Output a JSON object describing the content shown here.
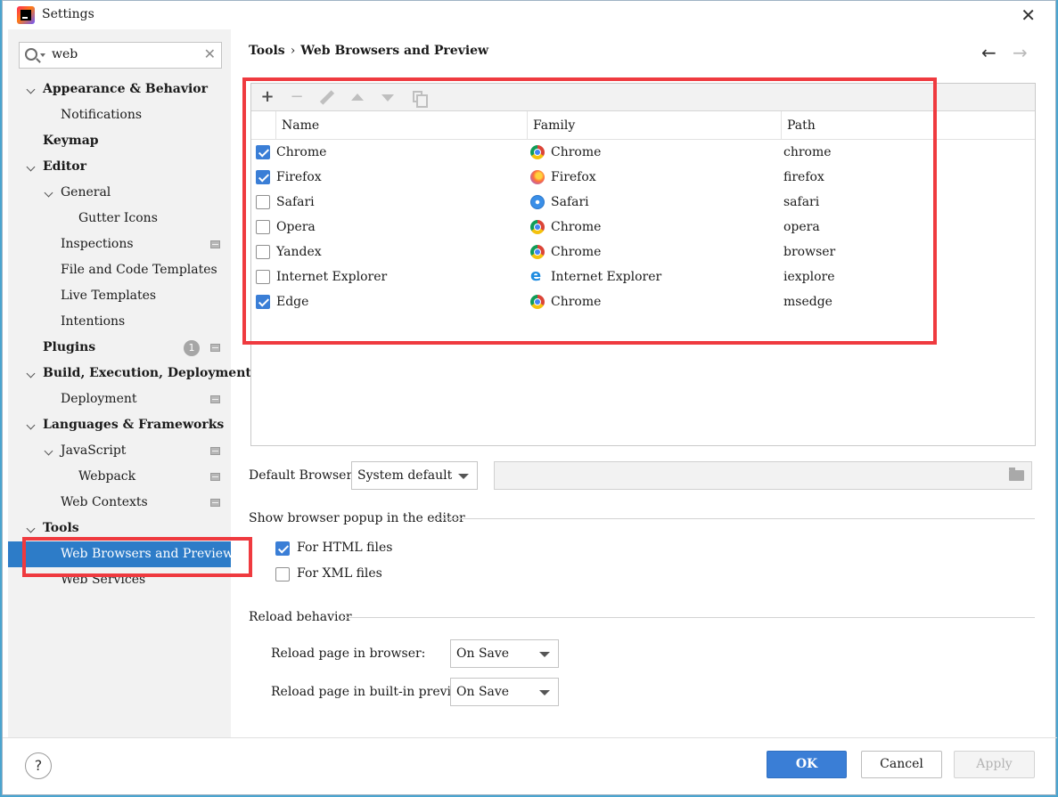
{
  "window": {
    "title": "Settings"
  },
  "search": {
    "value": "web"
  },
  "tree": [
    {
      "label": "Appearance & Behavior",
      "bold": true,
      "level": 0,
      "arrow": true
    },
    {
      "label": "Notifications",
      "bold": false,
      "level": 1
    },
    {
      "label": "Keymap",
      "bold": true,
      "level": 0
    },
    {
      "label": "Editor",
      "bold": true,
      "level": 0,
      "arrow": true
    },
    {
      "label": "General",
      "bold": false,
      "level": 1,
      "arrow": true
    },
    {
      "label": "Gutter Icons",
      "bold": false,
      "level": 2
    },
    {
      "label": "Inspections",
      "bold": false,
      "level": 1,
      "page_icon": true
    },
    {
      "label": "File and Code Templates",
      "bold": false,
      "level": 1
    },
    {
      "label": "Live Templates",
      "bold": false,
      "level": 1
    },
    {
      "label": "Intentions",
      "bold": false,
      "level": 1
    },
    {
      "label": "Plugins",
      "bold": true,
      "level": 0,
      "badge": "1",
      "page_icon": true
    },
    {
      "label": "Build, Execution, Deployment",
      "bold": true,
      "level": 0,
      "arrow": true
    },
    {
      "label": "Deployment",
      "bold": false,
      "level": 1,
      "page_icon": true
    },
    {
      "label": "Languages & Frameworks",
      "bold": true,
      "level": 0,
      "arrow": true
    },
    {
      "label": "JavaScript",
      "bold": false,
      "level": 1,
      "arrow": true,
      "page_icon": true
    },
    {
      "label": "Webpack",
      "bold": false,
      "level": 2,
      "page_icon": true
    },
    {
      "label": "Web Contexts",
      "bold": false,
      "level": 1,
      "page_icon": true
    },
    {
      "label": "Tools",
      "bold": true,
      "level": 0,
      "arrow": true
    },
    {
      "label": "Web Browsers and Preview",
      "bold": false,
      "level": 1,
      "selected": true
    },
    {
      "label": "Web Services",
      "bold": false,
      "level": 1
    }
  ],
  "breadcrumb": {
    "parent": "Tools",
    "separator": "›",
    "current": "Web Browsers and Preview"
  },
  "nav": {
    "back": "←",
    "forward": "→"
  },
  "toolbar": {
    "add": "+",
    "remove": "−"
  },
  "table": {
    "columns": [
      "Name",
      "Family",
      "Path"
    ],
    "rows": [
      {
        "checked": true,
        "name": "Chrome",
        "family": "Chrome",
        "family_icon": "chrome-icon",
        "path": "chrome"
      },
      {
        "checked": true,
        "name": "Firefox",
        "family": "Firefox",
        "family_icon": "firefox-icon",
        "path": "firefox"
      },
      {
        "checked": false,
        "name": "Safari",
        "family": "Safari",
        "family_icon": "safari-icon",
        "path": "safari"
      },
      {
        "checked": false,
        "name": "Opera",
        "family": "Chrome",
        "family_icon": "chrome-icon",
        "path": "opera"
      },
      {
        "checked": false,
        "name": "Yandex",
        "family": "Chrome",
        "family_icon": "chrome-icon",
        "path": "browser"
      },
      {
        "checked": false,
        "name": "Internet Explorer",
        "family": "Internet Explorer",
        "family_icon": "ie-icon",
        "path": "iexplore"
      },
      {
        "checked": true,
        "name": "Edge",
        "family": "Chrome",
        "family_icon": "chrome-icon",
        "path": "msedge"
      }
    ]
  },
  "default_browser": {
    "label": "Default Browser:",
    "value": "System default"
  },
  "popup": {
    "title": "Show browser popup in the editor",
    "html_label": "For HTML files",
    "html_checked": true,
    "xml_label": "For XML files",
    "xml_checked": false
  },
  "reload": {
    "title": "Reload behavior",
    "browser_label": "Reload page in browser:",
    "browser_value": "On Save",
    "preview_label": "Reload page in built-in preview:",
    "preview_value": "On Save"
  },
  "buttons": {
    "help": "?",
    "ok": "OK",
    "cancel": "Cancel",
    "apply": "Apply"
  },
  "colors": {
    "accent": "#3a7ed6",
    "selection": "#2d7cc8",
    "highlight_frame": "#ef3a3f"
  }
}
